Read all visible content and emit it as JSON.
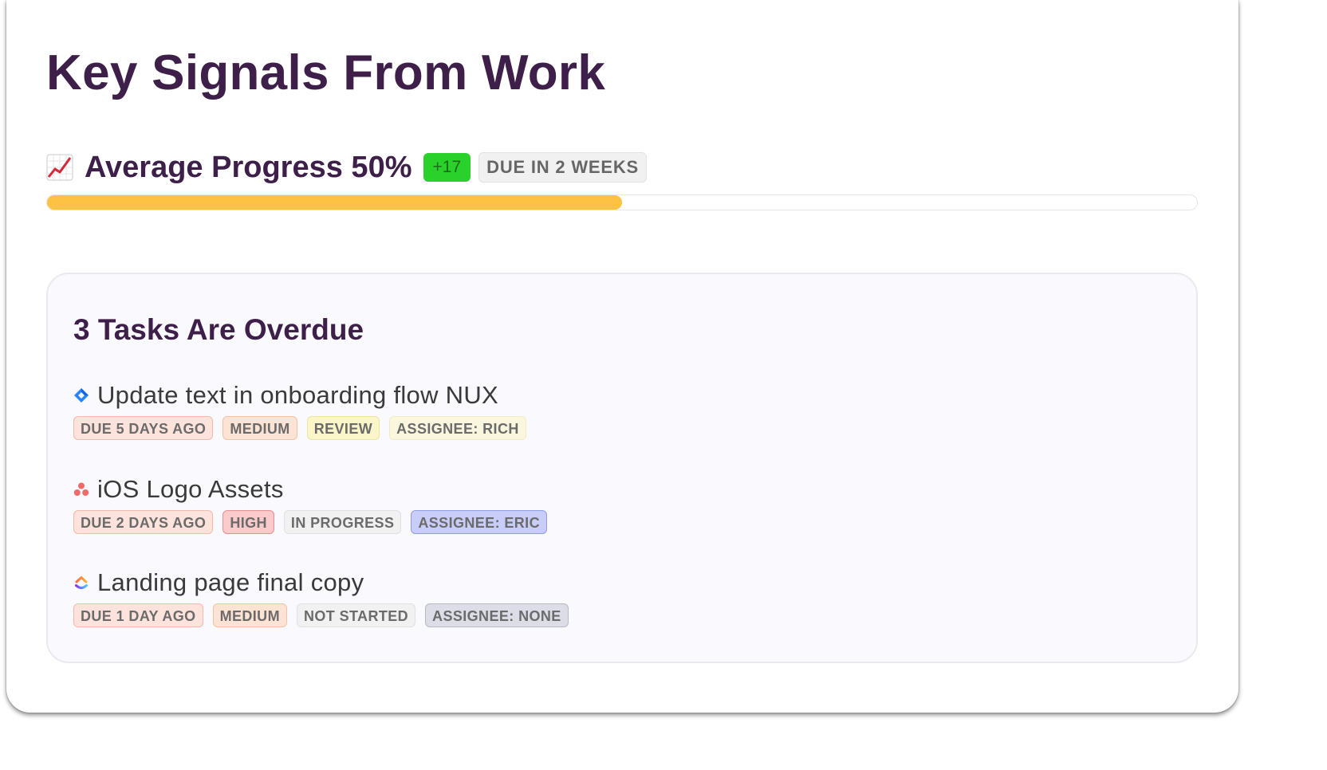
{
  "title": "Key Signals From Work",
  "progress": {
    "icon": "chart-increasing-icon",
    "label": "Average Progress 50%",
    "delta": "+17",
    "due": "DUE IN 2 WEEKS",
    "fraction": 0.5,
    "fill_color": "#fdc143",
    "delta_color": "#2ad12a"
  },
  "overdue": {
    "title": "3 Tasks Are Overdue",
    "tasks": [
      {
        "icon": "jira-diamond-icon",
        "name": "Update text in onboarding flow NUX",
        "tags": [
          "DUE 5 DAYS AGO",
          "MEDIUM",
          "REVIEW",
          "ASSIGNEE: RICH"
        ]
      },
      {
        "icon": "asana-dots-icon",
        "name": "iOS Logo Assets",
        "tags": [
          "DUE 2 DAYS AGO",
          "HIGH",
          "IN PROGRESS",
          "ASSIGNEE: ERIC"
        ]
      },
      {
        "icon": "clickup-chevron-icon",
        "name": "Landing page final copy",
        "tags": [
          "DUE 1 DAY AGO",
          "MEDIUM",
          "NOT STARTED",
          "ASSIGNEE: NONE"
        ]
      }
    ]
  }
}
